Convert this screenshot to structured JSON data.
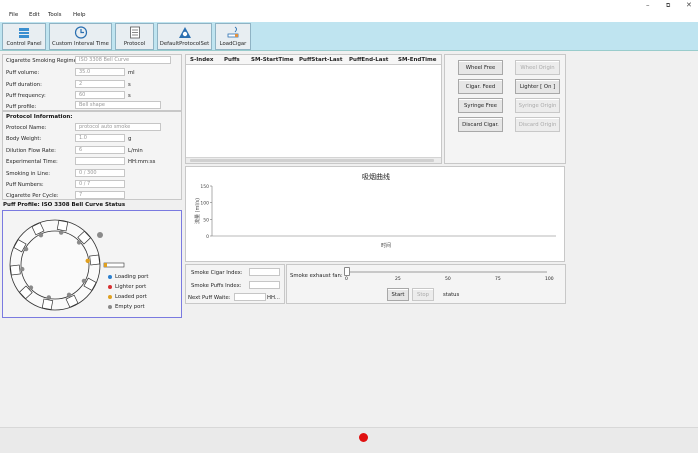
{
  "menu": [
    "File",
    "Edit",
    "Tools",
    "Help"
  ],
  "toolbar": [
    "Control Panel",
    "Custom Interval Time",
    "Protocol",
    "DefaultProtocolSet",
    "LoadCigar"
  ],
  "regimen": {
    "label": "Cigarette Smoking Regimens:",
    "value": "ISO 3308 Bell Curve"
  },
  "params": [
    {
      "label": "Puff volume:",
      "value": "35.0",
      "unit": "ml"
    },
    {
      "label": "Puff duration:",
      "value": "2",
      "unit": "s"
    },
    {
      "label": "Puff frequency:",
      "value": "60",
      "unit": "s"
    },
    {
      "label": "Puff profile:",
      "value": "Bell shape",
      "unit": ""
    }
  ],
  "protocol_title": "Protocol Information:",
  "protocol": [
    {
      "label": "Protocol Name:",
      "value": "protocol auto smoke",
      "unit": ""
    },
    {
      "label": "Body  Weight:",
      "value": "1.0",
      "unit": "g"
    },
    {
      "label": "Dilution Flow Rate:",
      "value": "6",
      "unit": "L/min"
    },
    {
      "label": "Experimental Time:",
      "value": "",
      "unit": "HH:mm:ss"
    },
    {
      "label": "Smoking in Line:",
      "value": "0  /  300",
      "unit": ""
    },
    {
      "label": "Puff Numbers:",
      "value": "0  /  7",
      "unit": ""
    },
    {
      "label": "Cigarette Per Cycle:",
      "value": "7",
      "unit": ""
    }
  ],
  "puff_profile_title": "Puff Profile: ISO 3308 Bell Curve Status",
  "legend": [
    {
      "label": "Loading port",
      "color": "#2a7fd0"
    },
    {
      "label": "Lighter port",
      "color": "#d83030"
    },
    {
      "label": "Loaded port",
      "color": "#e0a020"
    },
    {
      "label": "Empty port",
      "color": "#8a8a8a"
    }
  ],
  "table_headers": [
    "S-Index",
    "Puffs",
    "SM-StartTime",
    "PuffStart-Last",
    "PuffEnd-Last",
    "SM-EndTime"
  ],
  "buttons": [
    {
      "label": "Wheel Free",
      "enabled": true
    },
    {
      "label": "Wheel Origin",
      "enabled": false
    },
    {
      "label": "Cigar. Feed",
      "enabled": true
    },
    {
      "label": "Lighter [ On ]",
      "enabled": true
    },
    {
      "label": "Syringe Free",
      "enabled": true
    },
    {
      "label": "Syringe Origin",
      "enabled": false
    },
    {
      "label": "Discard Cigar.",
      "enabled": true
    },
    {
      "label": "Discard Origin",
      "enabled": false
    }
  ],
  "chart_data": {
    "type": "line",
    "title": "吸烟曲线",
    "xlabel": "时间",
    "ylabel": "流量 (ml/s)",
    "yticks": [
      "150",
      "100",
      "50",
      "0"
    ],
    "ylim": [
      0,
      150
    ],
    "series": []
  },
  "status": {
    "cigar_index_label": "Smoke Cigar Index:",
    "puffs_index_label": "Smoke Puffs Index:",
    "next_puff_label": "Next Puff Waite:",
    "next_puff_unit": "HH..."
  },
  "fan": {
    "label": "Smoke exhaust fan:",
    "ticks": [
      "0",
      "25",
      "50",
      "75",
      "100"
    ],
    "value": 0
  },
  "controls": {
    "start": "Start",
    "stop": "Stop",
    "status": "status"
  },
  "colors": {
    "toolbar": "#bfe4f0",
    "accent": "#6a6ae0",
    "record": "#e01010"
  }
}
